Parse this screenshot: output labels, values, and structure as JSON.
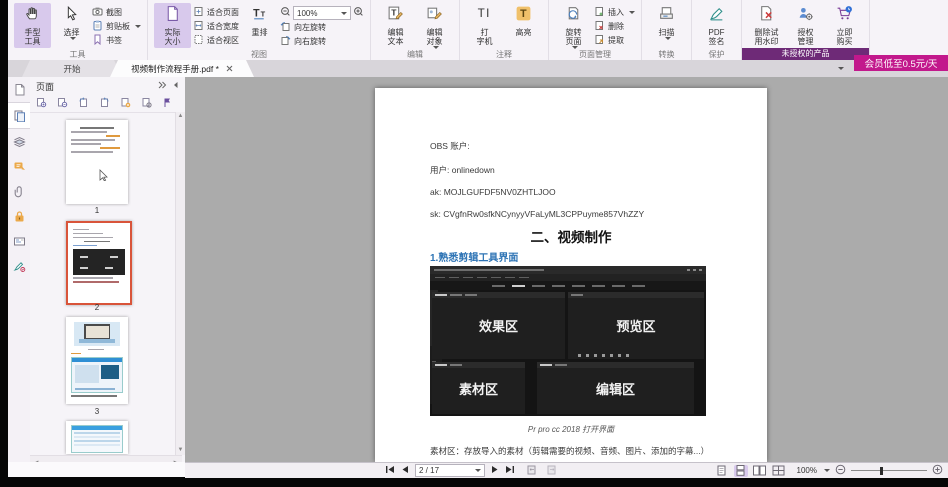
{
  "colors": {
    "accent_purple": "#7a3b96",
    "active_button_bg": "#d8c9ec",
    "highlight_orange": "#f0c06a",
    "unlicensed_band": "#6e2a77",
    "promo_badge": "#c2188c",
    "selected_thumb_border": "#d9543a",
    "doc_link_blue": "#2e74b5",
    "canvas_gray": "#ababab"
  },
  "ribbon": {
    "tools": {
      "label": "工具",
      "hand": "手型\n工具",
      "select": "选择",
      "snapshot": "截图",
      "clipboard": "剪贴板",
      "bookmark": "书签"
    },
    "view": {
      "label": "视图",
      "actual_size": "实际\n大小",
      "fit_page": "适合页面",
      "fit_width": "适合宽度",
      "fit_visible": "适合视区",
      "reflow": "重排",
      "zoom_value": "100%",
      "rotate_left": "向左旋转",
      "rotate_right": "向右旋转"
    },
    "edit": {
      "label": "编辑",
      "edit_text": "编辑\n文本",
      "edit_object": "编辑\n对象"
    },
    "comment": {
      "label": "注释",
      "typewriter": "打\n字机",
      "highlight": "高亮"
    },
    "pages": {
      "label": "页面管理",
      "rotate_pages": "旋转\n页面",
      "insert": "插入",
      "delete": "删除",
      "extract": "提取"
    },
    "convert": {
      "label": "转换",
      "scan": "扫描"
    },
    "protect": {
      "label": "保护",
      "pdf_sign": "PDF\n签名"
    },
    "unlicensed": {
      "label": "未授权的产品",
      "remove_watermark": "删除试\n用水印",
      "license": "授权\n管理",
      "buy": "立即\n购买"
    }
  },
  "tabbar": {
    "home_tab": "开始",
    "doc_tab": "视频制作流程手册.pdf *",
    "promo": "会员低至0.5元/天"
  },
  "pages_panel": {
    "title": "页面",
    "thumb1_num": "1",
    "thumb2_num": "2",
    "thumb3_num": "3"
  },
  "document": {
    "line_obs": "OBS 账户:",
    "line_user": "用户: onlinedown",
    "line_ak": "ak: MOJLGUFDF5NV0ZHTLJOO",
    "line_sk": "sk: CVgfnRw0sfkNCynyyVFaLyML3CPPuyme857VhZZY",
    "heading": "二、视频制作",
    "subheading": "1.熟悉剪辑工具界面",
    "figure": {
      "effects": "效果区",
      "preview": "预览区",
      "material": "素材区",
      "editing": "编辑区"
    },
    "caption": "Pr pro cc 2018 打开界面",
    "body": "素材区：存放导入的素材（剪辑需要的视频、音频、图片、添加的字幕...）"
  },
  "statusbar": {
    "page_value": "2 / 17",
    "zoom_value": "100%"
  }
}
